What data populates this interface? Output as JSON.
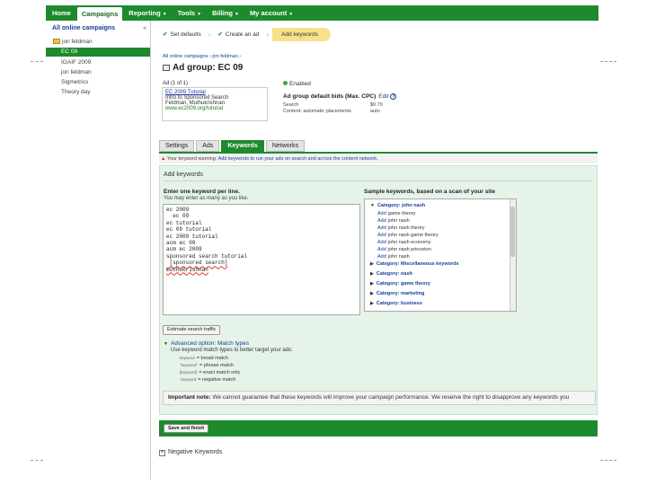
{
  "topnav": {
    "tabs": [
      {
        "label": "Home",
        "dropdown": false
      },
      {
        "label": "Campaigns",
        "dropdown": false,
        "active": true
      },
      {
        "label": "Reporting",
        "dropdown": true
      },
      {
        "label": "Tools",
        "dropdown": true
      },
      {
        "label": "Billing",
        "dropdown": true
      },
      {
        "label": "My account",
        "dropdown": true
      }
    ]
  },
  "sidebar": {
    "title": "All online campaigns",
    "collapse": "«",
    "root": "jon feldman",
    "items": [
      "EC 09",
      "IGAIF 2009",
      "jon feldman",
      "Sigmetrics",
      "Theory day"
    ],
    "selected_index": 0
  },
  "wizard": {
    "steps": [
      {
        "label": "Set defaults",
        "done": true
      },
      {
        "label": "Create an ad",
        "done": true
      },
      {
        "label": "Add keywords",
        "current": true
      }
    ]
  },
  "breadcrumb": "All online campaigns › jon feldman ›",
  "adgroup": {
    "title": "Ad group: EC 09"
  },
  "ads": {
    "label": "Ad (1 of 1)",
    "headline": "EC 2009 Tutorial",
    "line1": "Intro to Sponsored Search",
    "line2": "Feldman, Muthukrishnan",
    "url": "www.ec2009.org/tutorial"
  },
  "status": "Enabled",
  "bids": {
    "title": "Ad group default bids (Max. CPC)",
    "edit": "Edit",
    "help": "?",
    "rows": [
      {
        "label": "Search",
        "value": "$0.70"
      },
      {
        "label": "Content: automatic placements",
        "value": "auto"
      }
    ]
  },
  "content_tabs": [
    {
      "label": "Settings"
    },
    {
      "label": "Ads"
    },
    {
      "label": "Keywords",
      "active": true
    },
    {
      "label": "Networks"
    }
  ],
  "notice": {
    "icon": "▲",
    "prefix": "Your keyword warning:",
    "link": "Add keywords to run your ads on search and across the content network.",
    "rest": ""
  },
  "keywords": {
    "heading": "Add keywords",
    "enter_label": "Enter one keyword per line.",
    "enter_sub": "You may enter as many as you like.",
    "lines": [
      "ec 2009",
      "  ec 09",
      "ec tutorial",
      "ec 09 tutorial",
      "ec 2009 tutorial",
      "acm ec 09",
      "acm ec 2009",
      "sponsored search tutorial",
      " [sponsored search]",
      "muthukrishnan"
    ],
    "sample_label": "Sample keywords, based on a scan of your site",
    "sample_items": [
      {
        "type": "cat",
        "label": "Category: john nash",
        "expanded": true
      },
      {
        "type": "kw",
        "add": "Add",
        "label": "game theory"
      },
      {
        "type": "kw",
        "add": "Add",
        "label": "john nash"
      },
      {
        "type": "kw",
        "add": "Add",
        "label": "john nash theory"
      },
      {
        "type": "kw",
        "add": "Add",
        "label": "john nash game theory"
      },
      {
        "type": "kw",
        "add": "Add",
        "label": "john nash economy"
      },
      {
        "type": "kw",
        "add": "Add",
        "label": "john nash princeton"
      },
      {
        "type": "kw",
        "add": "Add",
        "label": "john nash"
      },
      {
        "type": "cat",
        "label": "Category: Miscellaneous keywords",
        "expanded": false
      },
      {
        "type": "cat",
        "label": "Category: nash",
        "expanded": false
      },
      {
        "type": "cat",
        "label": "Category: game theory",
        "expanded": false
      },
      {
        "type": "cat",
        "label": "Category: marketing",
        "expanded": false
      },
      {
        "type": "cat",
        "label": "Category: business",
        "expanded": false
      }
    ],
    "estimate_button": "Estimate search traffic",
    "advanced_label": "Advanced option: Match types",
    "advanced_sub": "Use keyword match types to better target your ads:",
    "match_types": [
      {
        "example": "keyword",
        "desc": "= broad match"
      },
      {
        "example": "\"keyword\"",
        "desc": "= phrase match"
      },
      {
        "example": "[keyword]",
        "desc": "= exact match only"
      },
      {
        "example": "-keyword",
        "desc": "= negative match"
      }
    ],
    "important_bold": "Important note:",
    "important_text": "We cannot guarantee that these keywords will improve your campaign performance. We reserve the right to disapprove any keywords you"
  },
  "save_button": "Save and finish",
  "negative": {
    "icon": "+",
    "label": "Negative Keywords"
  }
}
